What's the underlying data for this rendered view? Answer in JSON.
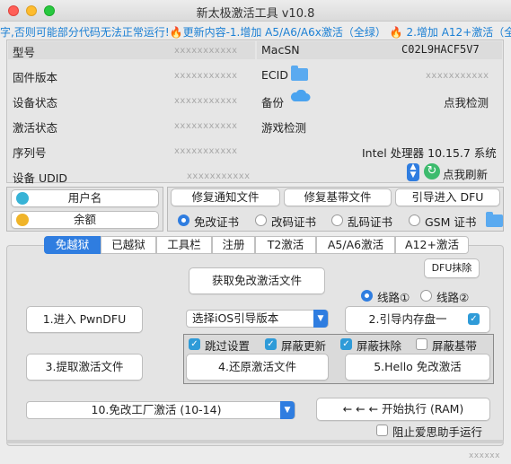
{
  "window": {
    "title": "新太极激活工具 v10.8"
  },
  "marquee": {
    "text": "字,否则可能部分代码无法正常运行!🔥更新内容-1.增加 A5/A6/A6x激活（全绿） 🔥 2.增加 A12+激活（全"
  },
  "info": {
    "model_label": "型号",
    "model_value": "xxxxxxxxxxx",
    "firmware_label": "固件版本",
    "firmware_value": "xxxxxxxxxxx",
    "device_status_label": "设备状态",
    "device_status_value": "xxxxxxxxxxx",
    "activation_status_label": "激活状态",
    "activation_status_value": "xxxxxxxxxxx",
    "serial_label": "序列号",
    "serial_value": "xxxxxxxxxxx",
    "udid_label": "设备 UDID",
    "udid_value": "xxxxxxxxxxx",
    "macsn_label": "MacSN",
    "macsn_value": "C02L9HACF5V7",
    "ecid_label": "ECID",
    "ecid_value": "xxxxxxxxxxx",
    "backup_label": "备份",
    "backup_value": "点我检测",
    "game_label": "游戏检测",
    "system_text": "Intel 处理器 10.15.7 系统",
    "refresh_label": "点我刷新"
  },
  "user": {
    "username_button": "用户名",
    "balance_button": "余额"
  },
  "repair": {
    "notify_button": "修复通知文件",
    "baseband_button": "修复基带文件",
    "dfu_button": "引导进入 DFU",
    "cert_options": [
      "免改证书",
      "改码证书",
      "乱码证书",
      "GSM 证书"
    ],
    "cert_selected": "免改证书"
  },
  "tabs": [
    "免越狱",
    "已越狱",
    "工具栏",
    "注册",
    "T2激活",
    "A5/A6激活",
    "A12+激活"
  ],
  "active_tab": "免越狱",
  "main": {
    "dfu_wipe_button": "DFU抹除",
    "get_file_button": "获取免改激活文件",
    "route_options": [
      "线路①",
      "线路②"
    ],
    "route_selected": "线路①",
    "pwndfu_button": "1.进入 PwnDFU",
    "ios_select": "选择iOS引导版本",
    "boot_ram_button": "2.引导内存盘一",
    "options": [
      {
        "label": "跳过设置",
        "checked": true
      },
      {
        "label": "屏蔽更新",
        "checked": true
      },
      {
        "label": "屏蔽抹除",
        "checked": true
      },
      {
        "label": "屏蔽基带",
        "checked": false
      }
    ],
    "extract_button": "3.提取激活文件",
    "restore_button": "4.还原激活文件",
    "hello_button": "5.Hello 免改激活",
    "factory_select": "10.免改工厂激活 (10-14)",
    "execute_button": "← ← ← 开始执行 (RAM)",
    "block_assistant_label": "阻止爱思助手运行",
    "block_assistant_checked": false
  },
  "footer": {
    "text": "xxxxxx"
  },
  "colors": {
    "accent": "#2f7de0",
    "marquee": "#1a7fd4",
    "check": "#2f9bd8"
  }
}
